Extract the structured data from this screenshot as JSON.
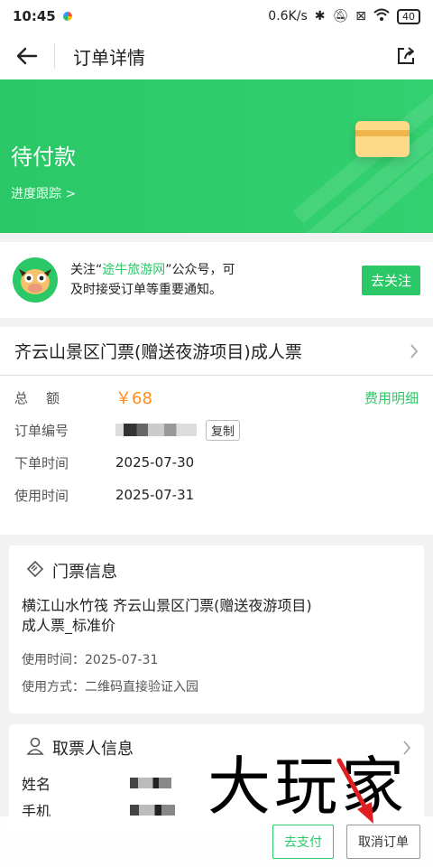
{
  "status_bar": {
    "time": "10:45",
    "network": "0.6K/s",
    "battery": "40"
  },
  "nav": {
    "title": "订单详情"
  },
  "hero": {
    "status": "待付款",
    "progress_link": "进度跟踪 >",
    "color": "#2ac866"
  },
  "follow": {
    "text_before": "关注“",
    "highlight": "途牛旅游网",
    "text_after": "”公众号，可",
    "line2": "及时接受订单等重要通知。",
    "button": "去关注"
  },
  "product": {
    "title": "齐云山景区门票(赠送夜游项目)成人票"
  },
  "order": {
    "total_label": "总额",
    "total_value": "￥68",
    "fee_detail": "费用明细",
    "order_no_label": "订单编号",
    "copy_label": "复制",
    "order_time_label": "下单时间",
    "order_time": "2025-07-30",
    "use_time_label": "使用时间",
    "use_time": "2025-07-31"
  },
  "ticket": {
    "title": "门票信息",
    "name_line1": "横江山水竹筏 齐云山景区门票(赠送夜游项目)",
    "name_line2": "成人票_标准价",
    "use_time": "使用时间：2025-07-31",
    "use_method": "使用方式：二维码直接验证入园"
  },
  "picker": {
    "title": "取票人信息",
    "name_label": "姓名",
    "phone_label": "手机"
  },
  "bottom": {
    "pay_label": "去支付",
    "cancel_label": "取消订单"
  },
  "watermark": "大玩家"
}
